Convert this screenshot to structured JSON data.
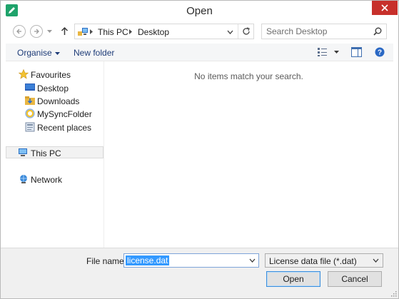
{
  "window": {
    "title": "Open",
    "close_icon": "close-x-icon"
  },
  "address_bar": {
    "breadcrumbs": [
      "This PC",
      "Desktop"
    ],
    "icons": [
      "back-icon",
      "forward-icon",
      "recent-dropdown-icon",
      "up-arrow-icon",
      "this-pc-icon",
      "refresh-icon"
    ]
  },
  "search": {
    "placeholder": "Search Desktop",
    "icon": "search-icon"
  },
  "toolbar": {
    "organise_label": "Organise",
    "new_folder_label": "New folder",
    "icons": [
      "view-options-icon",
      "preview-pane-icon",
      "help-icon"
    ]
  },
  "nav_pane": {
    "favourites": {
      "label": "Favourites",
      "icon": "star-icon",
      "items": [
        {
          "label": "Desktop",
          "icon": "desktop-icon"
        },
        {
          "label": "Downloads",
          "icon": "downloads-icon"
        },
        {
          "label": "MySyncFolder",
          "icon": "sync-folder-icon"
        },
        {
          "label": "Recent places",
          "icon": "recent-places-icon"
        }
      ]
    },
    "this_pc": {
      "label": "This PC",
      "icon": "computer-icon",
      "selected": true
    },
    "network": {
      "label": "Network",
      "icon": "network-icon"
    }
  },
  "content": {
    "empty_message": "No items match your search."
  },
  "footer": {
    "file_name_label": "File name:",
    "file_name_value": "license.dat",
    "file_type_value": "License data file (*.dat)",
    "open_label": "Open",
    "cancel_label": "Cancel"
  },
  "colors": {
    "close_button": "#c7302b",
    "selection_blue": "#3399ff",
    "toolbar_text": "#1e3c78",
    "bottom_panel": "#f0f0f0"
  }
}
